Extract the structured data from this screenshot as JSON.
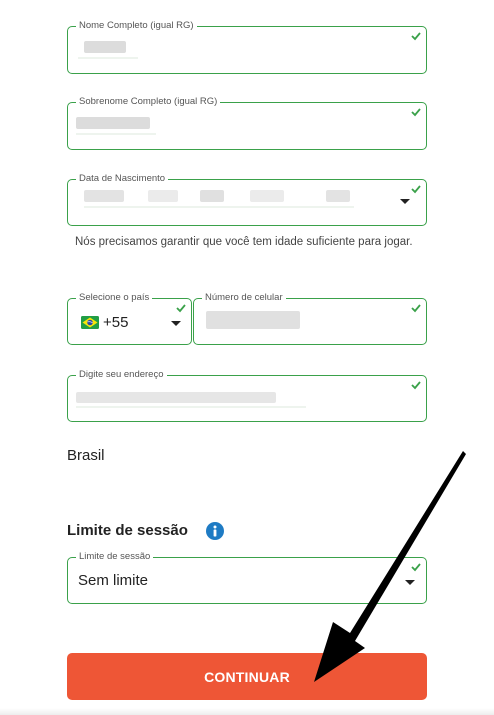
{
  "form": {
    "full_name": {
      "label": "Nome Completo (igual RG)",
      "value": ""
    },
    "last_name": {
      "label": "Sobrenome Completo (igual RG)",
      "value": ""
    },
    "birth_date": {
      "label": "Data de Nascimento",
      "value": ""
    },
    "age_notice": "Nós precisamos garantir que você tem idade suficiente para jogar.",
    "country_code": {
      "label": "Selecione o país",
      "dial_code": "+55",
      "flag_icon": "brazil-flag-icon"
    },
    "phone": {
      "label": "Número de celular",
      "value": ""
    },
    "address": {
      "label": "Digite seu endereço",
      "value": ""
    },
    "country_name": "Brasil"
  },
  "session": {
    "heading": "Limite de sessão",
    "field_label": "Limite de sessão",
    "value": "Sem limite"
  },
  "actions": {
    "continue_label": "CONTINUAR"
  },
  "colors": {
    "valid_border": "#3aa14a",
    "primary_button": "#ee5636",
    "info_icon": "#1e7bc4"
  }
}
